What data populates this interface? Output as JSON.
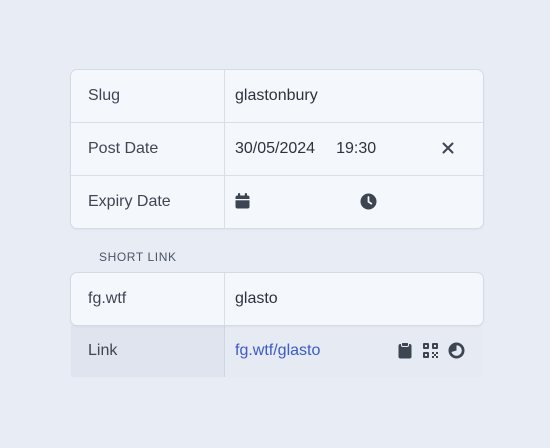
{
  "fields": {
    "slug": {
      "label": "Slug",
      "value": "glastonbury"
    },
    "post_date": {
      "label": "Post Date",
      "date": "30/05/2024",
      "time": "19:30"
    },
    "expiry_date": {
      "label": "Expiry Date",
      "date": "",
      "time": ""
    }
  },
  "short_link": {
    "section_title": "SHORT LINK",
    "domain": "fg.wtf",
    "value": "glasto",
    "link_label": "Link",
    "link_text": "fg.wtf/glasto"
  },
  "icons": {
    "clear": "close-icon",
    "date": "calendar-icon",
    "time": "clock-icon",
    "copy": "clipboard-icon",
    "qr": "qr-code-icon",
    "stats": "chart-icon"
  },
  "colors": {
    "accent_link": "#3b5bc7",
    "background": "#e8edf5",
    "card": "#f4f7fb"
  }
}
